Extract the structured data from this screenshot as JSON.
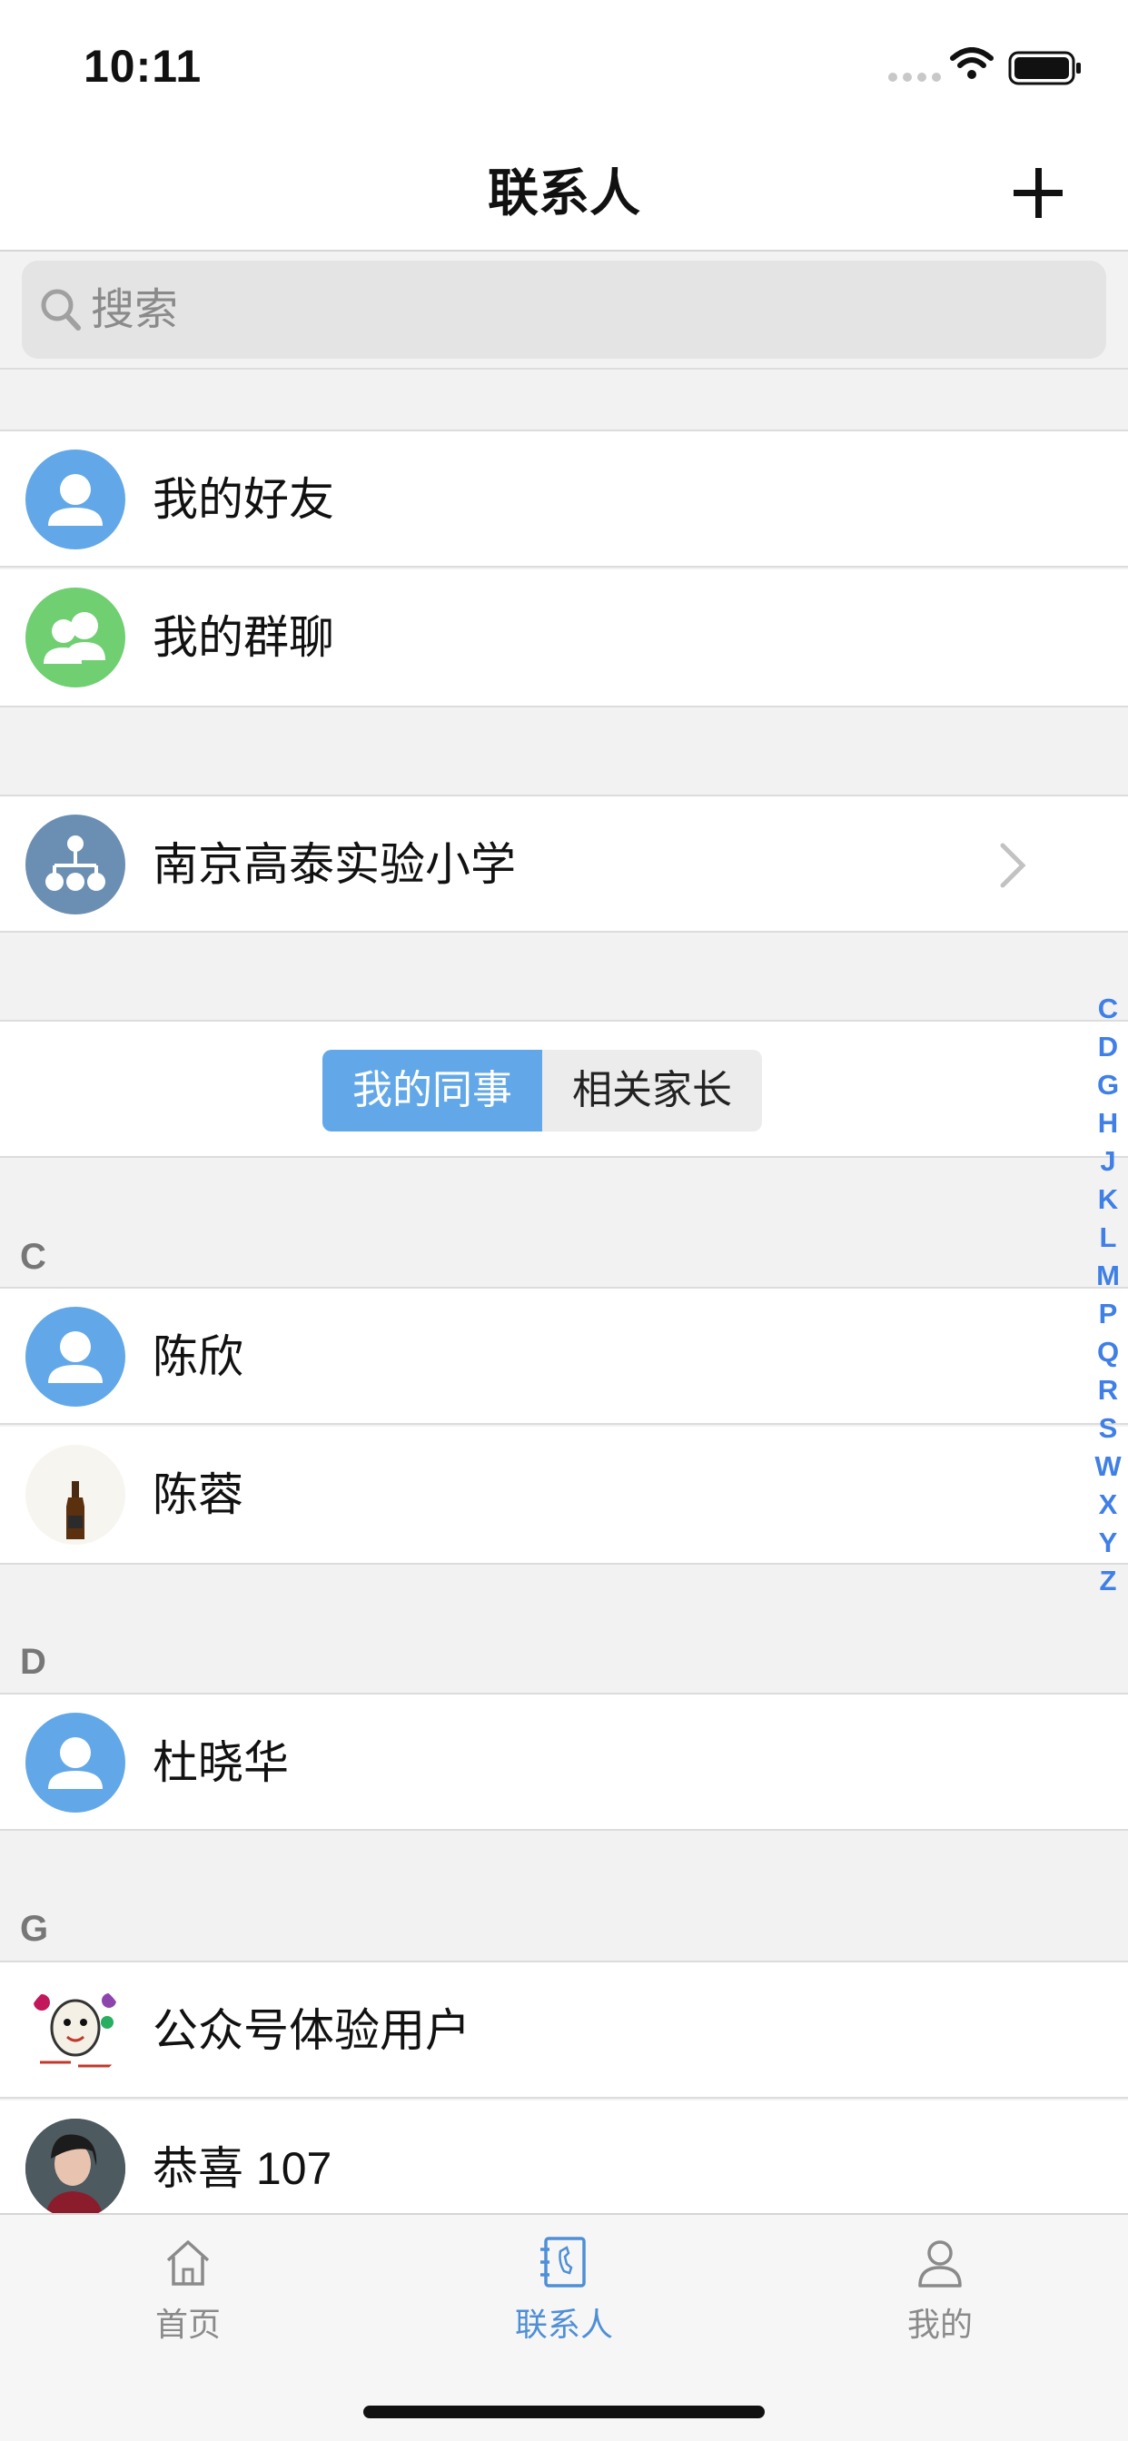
{
  "status_bar": {
    "time": "10:11"
  },
  "nav": {
    "title": "联系人"
  },
  "search": {
    "placeholder": "搜索"
  },
  "quick_items": [
    {
      "label": "我的好友",
      "icon": "person-icon",
      "color": "#62a8e8"
    },
    {
      "label": "我的群聊",
      "icon": "group-icon",
      "color": "#6fcf71"
    }
  ],
  "organization": {
    "label": "南京高泰实验小学",
    "icon": "org-chart-icon",
    "color": "#6b8fb3"
  },
  "segments": {
    "active": "我的同事",
    "inactive": "相关家长"
  },
  "sections": [
    {
      "letter": "C",
      "contacts": [
        "陈欣",
        "陈蓉"
      ]
    },
    {
      "letter": "D",
      "contacts": [
        "杜晓华"
      ]
    },
    {
      "letter": "G",
      "contacts": [
        "公众号体验用户",
        "恭喜 107"
      ]
    }
  ],
  "index_letters": [
    "C",
    "D",
    "G",
    "H",
    "J",
    "K",
    "L",
    "M",
    "P",
    "Q",
    "R",
    "S",
    "W",
    "X",
    "Y",
    "Z"
  ],
  "tabs": [
    {
      "label": "首页",
      "icon": "home-icon"
    },
    {
      "label": "联系人",
      "icon": "contacts-book-icon",
      "active": true
    },
    {
      "label": "我的",
      "icon": "profile-icon"
    }
  ],
  "colors": {
    "accent": "#62a8e8",
    "index": "#3f7fe6",
    "tab_active": "#4f8fd6"
  }
}
